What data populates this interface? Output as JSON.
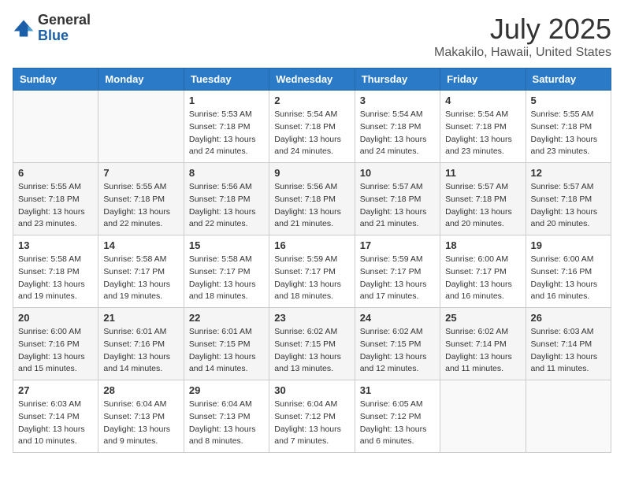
{
  "logo": {
    "general": "General",
    "blue": "Blue"
  },
  "header": {
    "title": "July 2025",
    "subtitle": "Makakilo, Hawaii, United States"
  },
  "weekdays": [
    "Sunday",
    "Monday",
    "Tuesday",
    "Wednesday",
    "Thursday",
    "Friday",
    "Saturday"
  ],
  "weeks": [
    [
      {
        "day": "",
        "sunrise": "",
        "sunset": "",
        "daylight": ""
      },
      {
        "day": "",
        "sunrise": "",
        "sunset": "",
        "daylight": ""
      },
      {
        "day": "1",
        "sunrise": "Sunrise: 5:53 AM",
        "sunset": "Sunset: 7:18 PM",
        "daylight": "Daylight: 13 hours and 24 minutes."
      },
      {
        "day": "2",
        "sunrise": "Sunrise: 5:54 AM",
        "sunset": "Sunset: 7:18 PM",
        "daylight": "Daylight: 13 hours and 24 minutes."
      },
      {
        "day": "3",
        "sunrise": "Sunrise: 5:54 AM",
        "sunset": "Sunset: 7:18 PM",
        "daylight": "Daylight: 13 hours and 24 minutes."
      },
      {
        "day": "4",
        "sunrise": "Sunrise: 5:54 AM",
        "sunset": "Sunset: 7:18 PM",
        "daylight": "Daylight: 13 hours and 23 minutes."
      },
      {
        "day": "5",
        "sunrise": "Sunrise: 5:55 AM",
        "sunset": "Sunset: 7:18 PM",
        "daylight": "Daylight: 13 hours and 23 minutes."
      }
    ],
    [
      {
        "day": "6",
        "sunrise": "Sunrise: 5:55 AM",
        "sunset": "Sunset: 7:18 PM",
        "daylight": "Daylight: 13 hours and 23 minutes."
      },
      {
        "day": "7",
        "sunrise": "Sunrise: 5:55 AM",
        "sunset": "Sunset: 7:18 PM",
        "daylight": "Daylight: 13 hours and 22 minutes."
      },
      {
        "day": "8",
        "sunrise": "Sunrise: 5:56 AM",
        "sunset": "Sunset: 7:18 PM",
        "daylight": "Daylight: 13 hours and 22 minutes."
      },
      {
        "day": "9",
        "sunrise": "Sunrise: 5:56 AM",
        "sunset": "Sunset: 7:18 PM",
        "daylight": "Daylight: 13 hours and 21 minutes."
      },
      {
        "day": "10",
        "sunrise": "Sunrise: 5:57 AM",
        "sunset": "Sunset: 7:18 PM",
        "daylight": "Daylight: 13 hours and 21 minutes."
      },
      {
        "day": "11",
        "sunrise": "Sunrise: 5:57 AM",
        "sunset": "Sunset: 7:18 PM",
        "daylight": "Daylight: 13 hours and 20 minutes."
      },
      {
        "day": "12",
        "sunrise": "Sunrise: 5:57 AM",
        "sunset": "Sunset: 7:18 PM",
        "daylight": "Daylight: 13 hours and 20 minutes."
      }
    ],
    [
      {
        "day": "13",
        "sunrise": "Sunrise: 5:58 AM",
        "sunset": "Sunset: 7:18 PM",
        "daylight": "Daylight: 13 hours and 19 minutes."
      },
      {
        "day": "14",
        "sunrise": "Sunrise: 5:58 AM",
        "sunset": "Sunset: 7:17 PM",
        "daylight": "Daylight: 13 hours and 19 minutes."
      },
      {
        "day": "15",
        "sunrise": "Sunrise: 5:58 AM",
        "sunset": "Sunset: 7:17 PM",
        "daylight": "Daylight: 13 hours and 18 minutes."
      },
      {
        "day": "16",
        "sunrise": "Sunrise: 5:59 AM",
        "sunset": "Sunset: 7:17 PM",
        "daylight": "Daylight: 13 hours and 18 minutes."
      },
      {
        "day": "17",
        "sunrise": "Sunrise: 5:59 AM",
        "sunset": "Sunset: 7:17 PM",
        "daylight": "Daylight: 13 hours and 17 minutes."
      },
      {
        "day": "18",
        "sunrise": "Sunrise: 6:00 AM",
        "sunset": "Sunset: 7:17 PM",
        "daylight": "Daylight: 13 hours and 16 minutes."
      },
      {
        "day": "19",
        "sunrise": "Sunrise: 6:00 AM",
        "sunset": "Sunset: 7:16 PM",
        "daylight": "Daylight: 13 hours and 16 minutes."
      }
    ],
    [
      {
        "day": "20",
        "sunrise": "Sunrise: 6:00 AM",
        "sunset": "Sunset: 7:16 PM",
        "daylight": "Daylight: 13 hours and 15 minutes."
      },
      {
        "day": "21",
        "sunrise": "Sunrise: 6:01 AM",
        "sunset": "Sunset: 7:16 PM",
        "daylight": "Daylight: 13 hours and 14 minutes."
      },
      {
        "day": "22",
        "sunrise": "Sunrise: 6:01 AM",
        "sunset": "Sunset: 7:15 PM",
        "daylight": "Daylight: 13 hours and 14 minutes."
      },
      {
        "day": "23",
        "sunrise": "Sunrise: 6:02 AM",
        "sunset": "Sunset: 7:15 PM",
        "daylight": "Daylight: 13 hours and 13 minutes."
      },
      {
        "day": "24",
        "sunrise": "Sunrise: 6:02 AM",
        "sunset": "Sunset: 7:15 PM",
        "daylight": "Daylight: 13 hours and 12 minutes."
      },
      {
        "day": "25",
        "sunrise": "Sunrise: 6:02 AM",
        "sunset": "Sunset: 7:14 PM",
        "daylight": "Daylight: 13 hours and 11 minutes."
      },
      {
        "day": "26",
        "sunrise": "Sunrise: 6:03 AM",
        "sunset": "Sunset: 7:14 PM",
        "daylight": "Daylight: 13 hours and 11 minutes."
      }
    ],
    [
      {
        "day": "27",
        "sunrise": "Sunrise: 6:03 AM",
        "sunset": "Sunset: 7:14 PM",
        "daylight": "Daylight: 13 hours and 10 minutes."
      },
      {
        "day": "28",
        "sunrise": "Sunrise: 6:04 AM",
        "sunset": "Sunset: 7:13 PM",
        "daylight": "Daylight: 13 hours and 9 minutes."
      },
      {
        "day": "29",
        "sunrise": "Sunrise: 6:04 AM",
        "sunset": "Sunset: 7:13 PM",
        "daylight": "Daylight: 13 hours and 8 minutes."
      },
      {
        "day": "30",
        "sunrise": "Sunrise: 6:04 AM",
        "sunset": "Sunset: 7:12 PM",
        "daylight": "Daylight: 13 hours and 7 minutes."
      },
      {
        "day": "31",
        "sunrise": "Sunrise: 6:05 AM",
        "sunset": "Sunset: 7:12 PM",
        "daylight": "Daylight: 13 hours and 6 minutes."
      },
      {
        "day": "",
        "sunrise": "",
        "sunset": "",
        "daylight": ""
      },
      {
        "day": "",
        "sunrise": "",
        "sunset": "",
        "daylight": ""
      }
    ]
  ]
}
